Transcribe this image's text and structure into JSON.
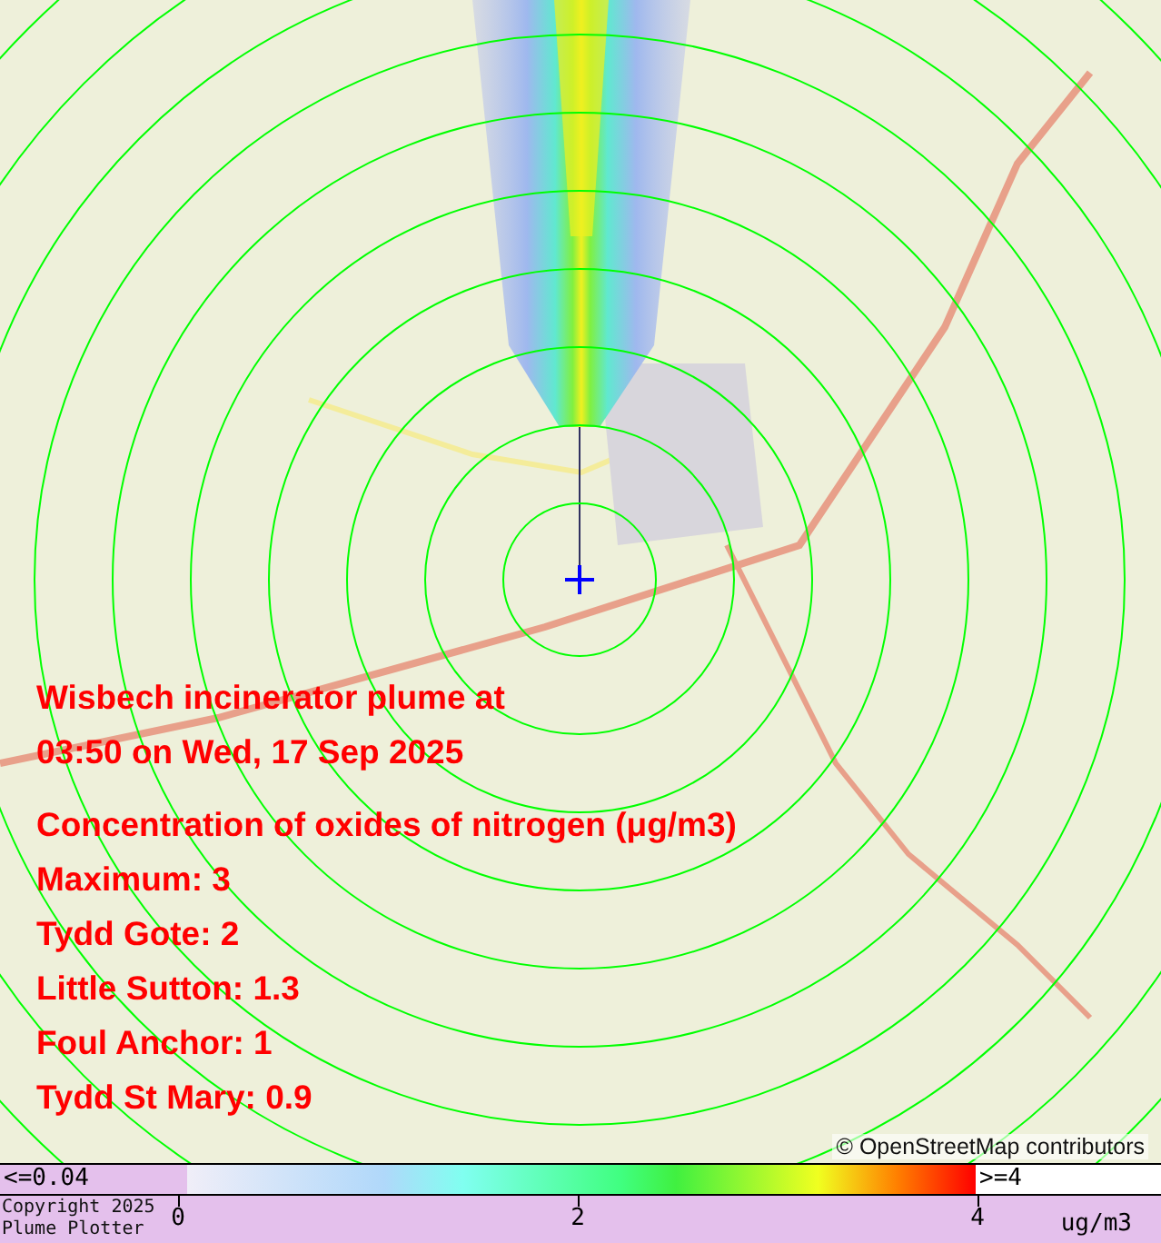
{
  "map": {
    "attribution": "© OpenStreetMap contributors"
  },
  "overlay": {
    "title_lines": [
      "Wisbech incinerator plume at",
      "03:50 on Wed, 17 Sep 2025"
    ],
    "heading": "Concentration of oxides of nitrogen (μg/m3)",
    "readings": [
      "Maximum: 3",
      "Tydd Gote: 2",
      "Little Sutton: 1.3",
      "Foul Anchor: 1",
      "Tydd St Mary: 0.9"
    ]
  },
  "legend": {
    "min_label": "<=0.04",
    "max_label": ">=4",
    "ticks": [
      "0",
      "2",
      "4"
    ],
    "unit": "ug/m3",
    "copyright": [
      "Copyright 2025",
      "Plume Plotter"
    ]
  }
}
